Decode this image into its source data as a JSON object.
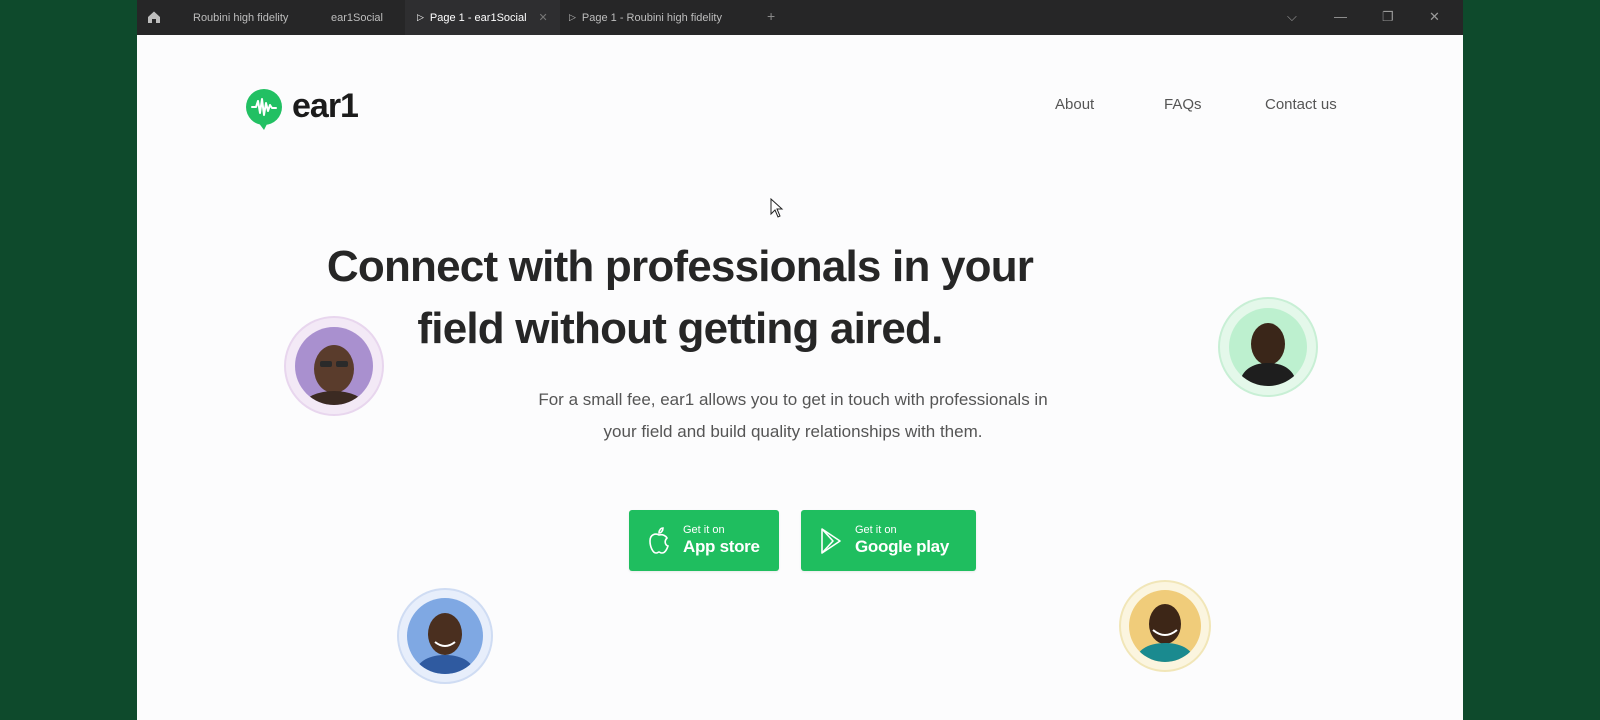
{
  "titlebar": {
    "tabs": [
      {
        "label": "Roubini high fidelity",
        "active": false,
        "play": false
      },
      {
        "label": "ear1Social",
        "active": false,
        "play": false
      },
      {
        "label": "Page 1 - ear1Social",
        "active": true,
        "play": true
      },
      {
        "label": "Page 1 - Roubini high fidelity",
        "active": false,
        "play": true
      }
    ],
    "plus": "+",
    "chevron": "⌵",
    "minimize": "—",
    "restore": "❐",
    "close": "✕",
    "tab_close": "✕"
  },
  "brand": {
    "name": "ear1",
    "color": "#22c063"
  },
  "nav": {
    "about": "About",
    "faqs": "FAQs",
    "contact": "Contact us"
  },
  "hero": {
    "title_line1": "Connect with professionals in your",
    "title_line2": "field without getting aired.",
    "subtitle_line1": "For a small fee, ear1 allows you to get in touch with professionals in",
    "subtitle_line2": "your field and build quality relationships with them."
  },
  "buttons": {
    "appstore": {
      "small": "Get it on",
      "big": "App store"
    },
    "googleplay": {
      "small": "Get it on",
      "big": "Google play"
    }
  },
  "avatars": [
    "avatar-purple",
    "avatar-green",
    "avatar-blue",
    "avatar-yellow"
  ]
}
